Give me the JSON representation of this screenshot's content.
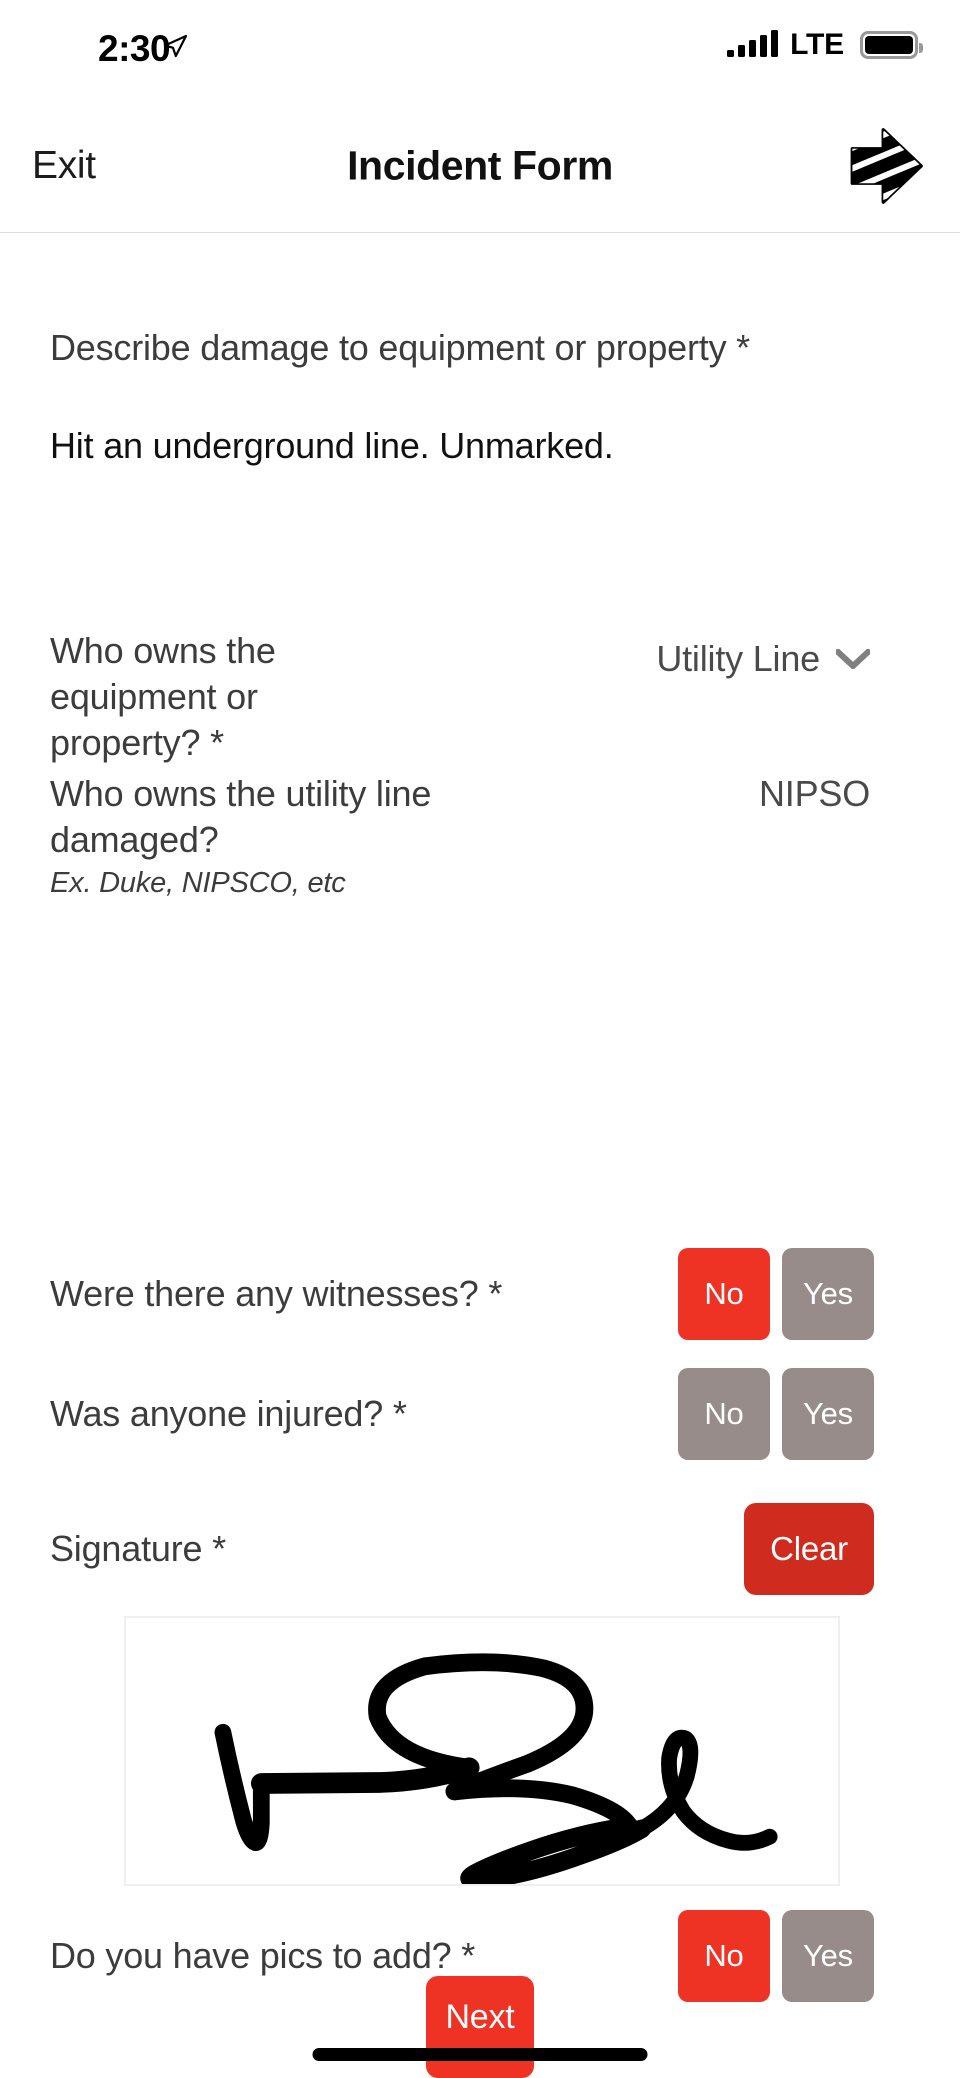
{
  "status_bar": {
    "time": "2:30",
    "location_icon": "location-arrow-icon",
    "signal_icon": "signal-bars-icon",
    "network": "LTE",
    "battery_icon": "battery-full-icon"
  },
  "nav": {
    "exit_label": "Exit",
    "title": "Incident Form",
    "logo_icon": "striped-arrow-logo-icon"
  },
  "form": {
    "describe": {
      "label": "Describe damage to equipment or property *",
      "value": "Hit an underground line. Unmarked."
    },
    "owner": {
      "label": "Who owns the equipment or property? *",
      "value": "Utility Line",
      "chevron_icon": "chevron-down-icon"
    },
    "utility_owner": {
      "label": "Who owns the utility line damaged?",
      "hint": "Ex. Duke, NIPSCO, etc",
      "value": "NIPSO"
    },
    "witnesses": {
      "label": "Were there any witnesses? *",
      "no_label": "No",
      "yes_label": "Yes",
      "selected": "No"
    },
    "injured": {
      "label": "Was anyone injured? *",
      "no_label": "No",
      "yes_label": "Yes",
      "selected": ""
    },
    "signature": {
      "label": "Signature *",
      "clear_label": "Clear",
      "has_signature": true
    },
    "pics": {
      "label": "Do you have pics to add? *",
      "no_label": "No",
      "yes_label": "Yes",
      "selected": "No"
    }
  },
  "footer": {
    "next_label": "Next",
    "home_indicator": "home-indicator"
  },
  "colors": {
    "accent_red": "#ee3224",
    "clear_red": "#cf2b1e",
    "unselected_grey": "#978c8a",
    "label_grey": "#3c3c3c"
  }
}
